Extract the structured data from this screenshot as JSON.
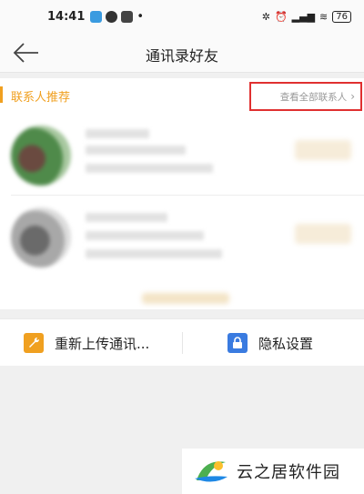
{
  "status_bar": {
    "time": "14:41",
    "battery": "76"
  },
  "nav": {
    "title": "通讯录好友",
    "back_icon": "arrow-left-icon"
  },
  "recommend": {
    "section_title": "联系人推荐",
    "view_all_label": "查看全部联系人",
    "accent": "#f0a020",
    "highlight_color": "#e03030"
  },
  "actions": {
    "upload_label": "重新上传通讯...",
    "upload_icon": "wrench-icon",
    "upload_color": "#f0a020",
    "privacy_label": "隐私设置",
    "privacy_icon": "lock-icon",
    "privacy_color": "#3a7be0"
  },
  "watermark": {
    "text": "云之居软件园"
  }
}
